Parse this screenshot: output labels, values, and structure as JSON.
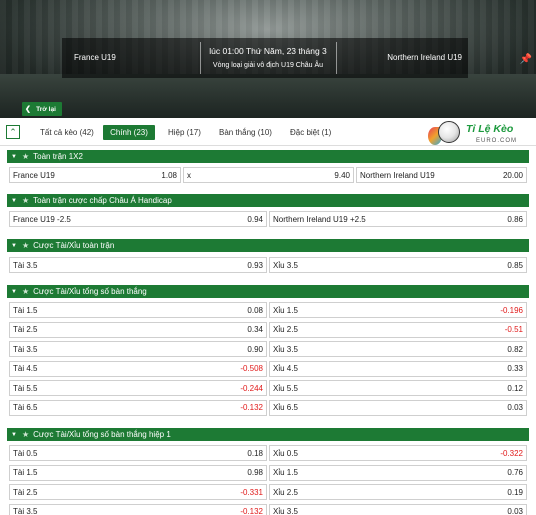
{
  "banner": {
    "home_team": "France U19",
    "away_team": "Northern Ireland U19",
    "kickoff": "lúc 01:00 Thứ Năm, 23 tháng 3",
    "league": "Vòng loại giải vô địch U19 Châu Âu",
    "back_label": "Trở lại"
  },
  "tabs": [
    {
      "label": "Tất cả kèo (42)"
    },
    {
      "label": "Chính (23)"
    },
    {
      "label": "Hiệp (17)"
    },
    {
      "label": "Bàn thắng (10)"
    },
    {
      "label": "Đặc biệt (1)"
    }
  ],
  "logo": {
    "brand": "Tỉ Lệ Kèo",
    "sub": "EURO.COM"
  },
  "sections": [
    {
      "title": "Toàn trận 1X2",
      "rows": [
        [
          {
            "label": "France U19",
            "odd": "1.08"
          },
          {
            "label": "x",
            "odd": "9.40"
          },
          {
            "label": "Northern Ireland U19",
            "odd": "20.00"
          }
        ]
      ]
    },
    {
      "title": "Toàn trận cược chấp Châu Á Handicap",
      "rows": [
        [
          {
            "label": "France U19",
            "line": "-2.5",
            "odd": "0.94"
          },
          {
            "label": "Northern Ireland U19",
            "line": "+2.5",
            "odd": "0.86"
          }
        ]
      ]
    },
    {
      "title": "Cược Tài/Xỉu toàn trận",
      "rows": [
        [
          {
            "label": "Tài 3.5",
            "odd": "0.93"
          },
          {
            "label": "Xỉu 3.5",
            "odd": "0.85"
          }
        ]
      ]
    },
    {
      "title": "Cược Tài/Xỉu tổng số bàn thắng",
      "rows": [
        [
          {
            "label": "Tài 1.5",
            "odd": "0.08"
          },
          {
            "label": "Xỉu 1.5",
            "odd": "-0.196"
          }
        ],
        [
          {
            "label": "Tài 2.5",
            "odd": "0.34"
          },
          {
            "label": "Xỉu 2.5",
            "odd": "-0.51"
          }
        ],
        [
          {
            "label": "Tài 3.5",
            "odd": "0.90"
          },
          {
            "label": "Xỉu 3.5",
            "odd": "0.82"
          }
        ],
        [
          {
            "label": "Tài 4.5",
            "odd": "-0.508"
          },
          {
            "label": "Xỉu 4.5",
            "odd": "0.33"
          }
        ],
        [
          {
            "label": "Tài 5.5",
            "odd": "-0.244"
          },
          {
            "label": "Xỉu 5.5",
            "odd": "0.12"
          }
        ],
        [
          {
            "label": "Tài 6.5",
            "odd": "-0.132"
          },
          {
            "label": "Xỉu 6.5",
            "odd": "0.03"
          }
        ]
      ]
    },
    {
      "title": "Cược Tài/Xỉu tổng số bàn thắng hiệp 1",
      "rows": [
        [
          {
            "label": "Tài 0.5",
            "odd": "0.18"
          },
          {
            "label": "Xỉu 0.5",
            "odd": "-0.322"
          }
        ],
        [
          {
            "label": "Tài 1.5",
            "odd": "0.98"
          },
          {
            "label": "Xỉu 1.5",
            "odd": "0.76"
          }
        ],
        [
          {
            "label": "Tài 2.5",
            "odd": "-0.331"
          },
          {
            "label": "Xỉu 2.5",
            "odd": "0.19"
          }
        ],
        [
          {
            "label": "Tài 3.5",
            "odd": "-0.132"
          },
          {
            "label": "Xỉu 3.5",
            "odd": "0.03"
          }
        ]
      ]
    }
  ],
  "colors": {
    "accent": "#1d7a34",
    "negative": "#e01919"
  }
}
